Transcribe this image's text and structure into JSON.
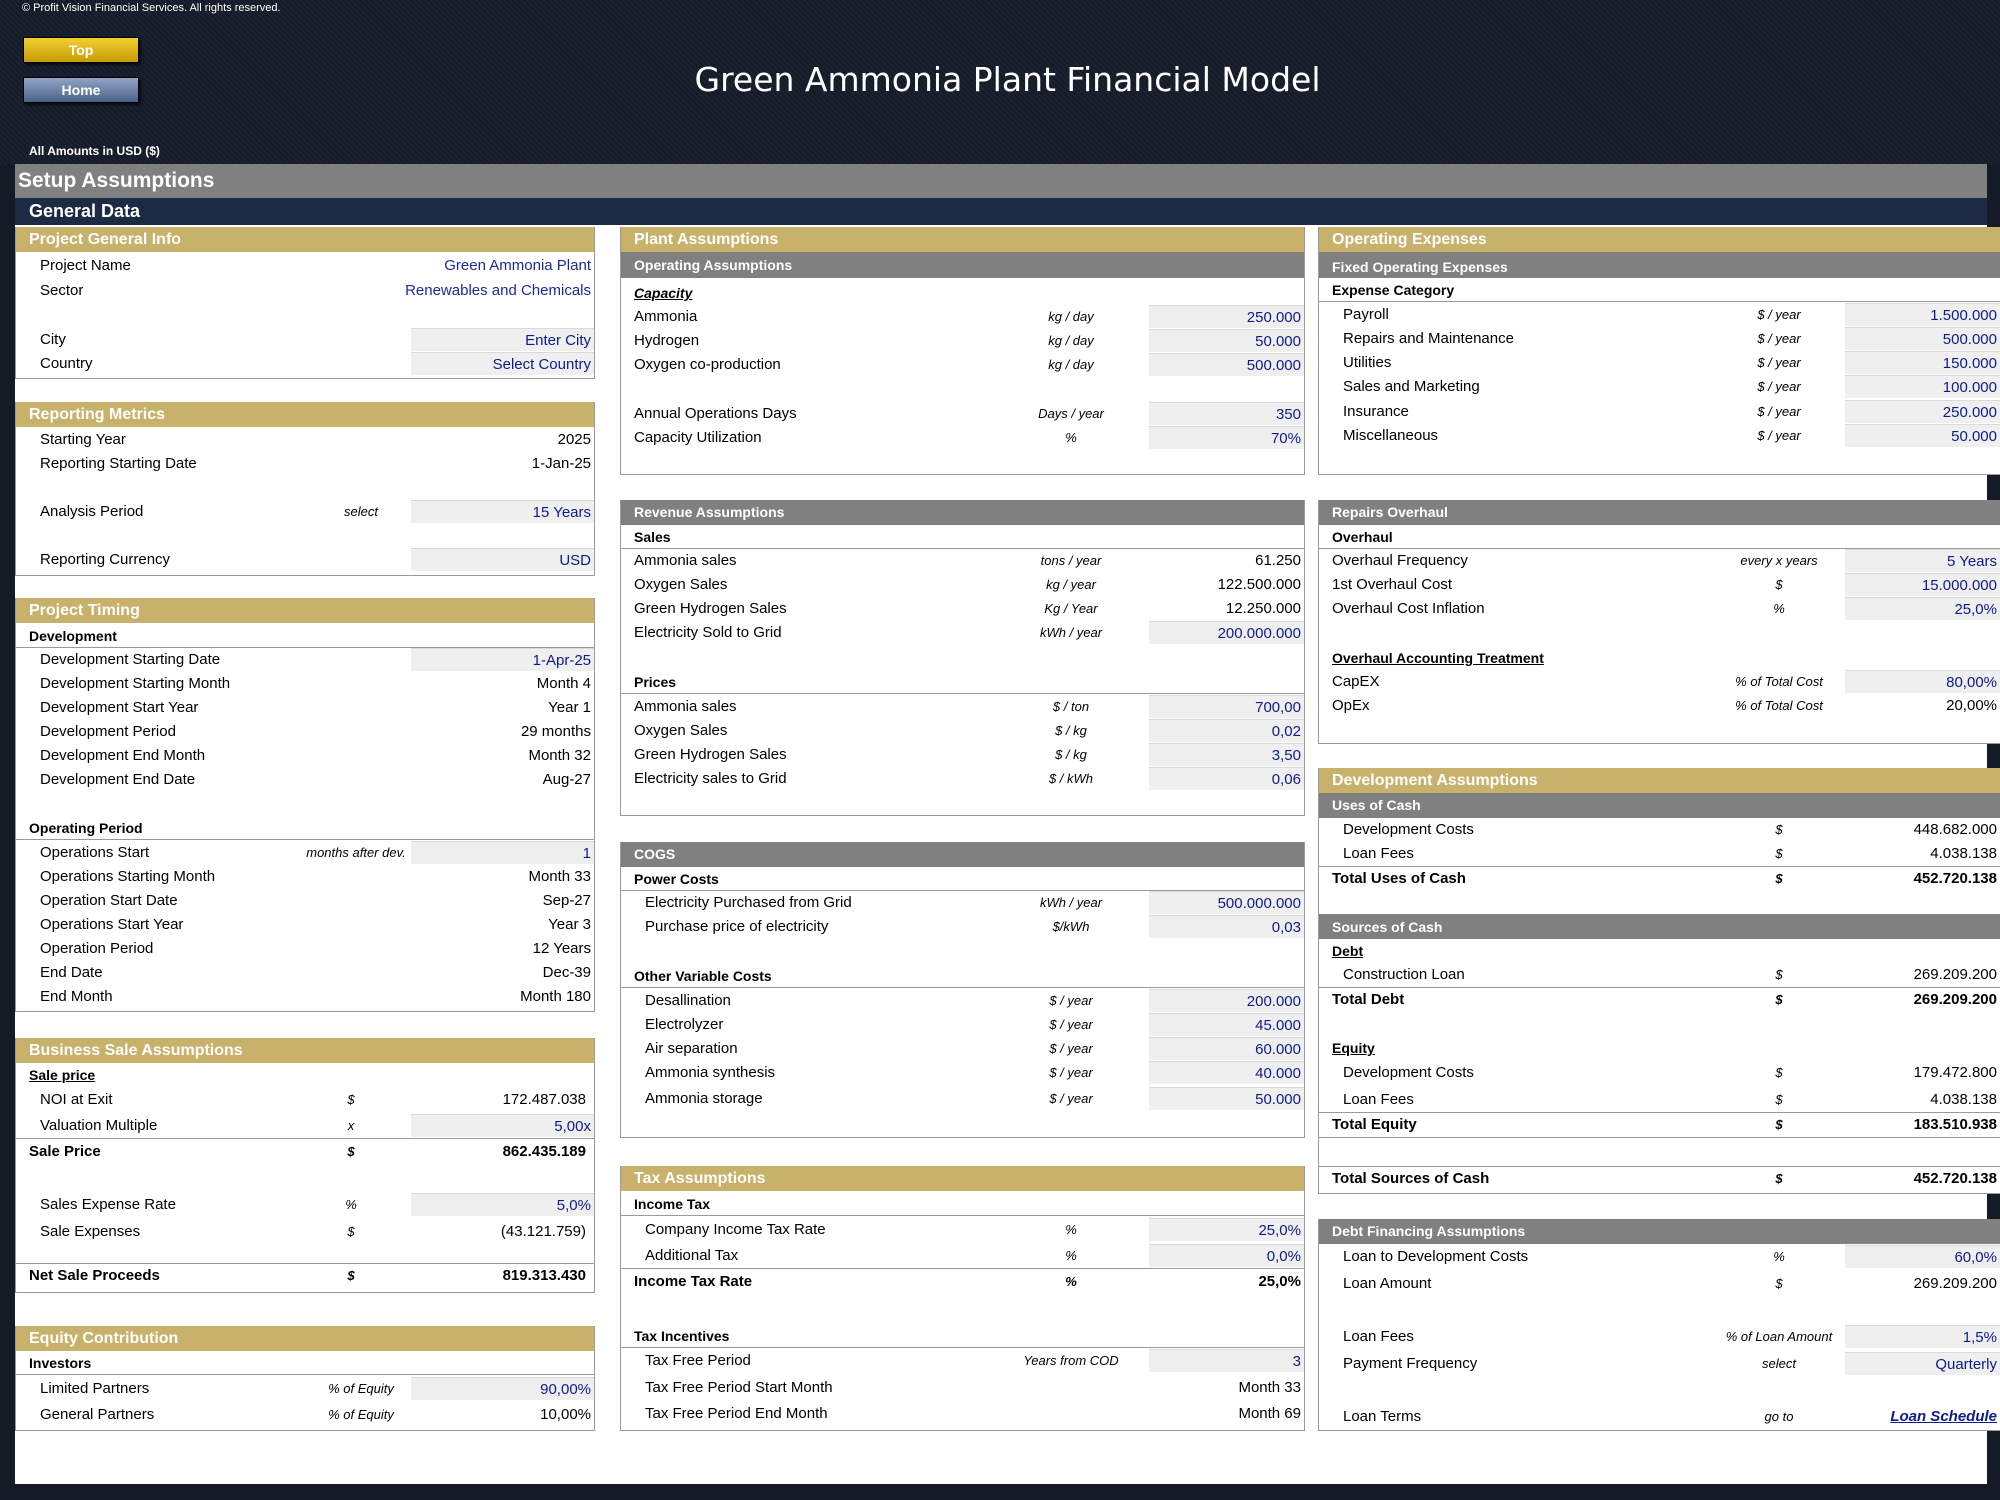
{
  "header": {
    "copyright": "© Profit Vision Financial Services. All rights reserved.",
    "top_button": "Top",
    "home_button": "Home",
    "title": "Green Ammonia Plant Financial Model",
    "amounts": "All Amounts in  USD ($)"
  },
  "sheet": {
    "setup": "Setup Assumptions",
    "general": "General Data"
  },
  "pgi": {
    "title": "Project General Info",
    "project_name_label": "Project Name",
    "project_name": "Green Ammonia Plant",
    "sector_label": "Sector",
    "sector": "Renewables and Chemicals",
    "city_label": "City",
    "city": "Enter City",
    "country_label": "Country",
    "country": "Select Country"
  },
  "rm": {
    "title": "Reporting Metrics",
    "starting_year_label": "Starting Year",
    "starting_year": "2025",
    "start_date_label": "Reporting Starting Date",
    "start_date": "1-Jan-25",
    "analysis_label": "Analysis Period",
    "analysis_unit": "select",
    "analysis": "15 Years",
    "currency_label": "Reporting Currency",
    "currency": "USD"
  },
  "pt": {
    "title": "Project Timing",
    "dev": "Development",
    "r1_label": "Development Starting Date",
    "r1": "1-Apr-25",
    "r2_label": "Development Starting Month",
    "r2": "Month 4",
    "r3_label": "Development Start Year",
    "r3": "Year 1",
    "r4_label": "Development Period",
    "r4": "29 months",
    "r5_label": "Development End Month",
    "r5": "Month 32",
    "r6_label": "Development End Date",
    "r6": "Aug-27",
    "op": "Operating Period",
    "o1_label": "Operations Start",
    "o1_unit": "months after dev.",
    "o1": "1",
    "o2_label": "Operations Starting Month",
    "o2": "Month 33",
    "o3_label": "Operation Start Date",
    "o3": "Sep-27",
    "o4_label": "Operations Start Year",
    "o4": "Year 3",
    "o5_label": "Operation Period",
    "o5": "12 Years",
    "o6_label": "End Date",
    "o6": "Dec-39",
    "o7_label": "End Month",
    "o7": "Month 180"
  },
  "bs": {
    "title": "Business Sale Assumptions",
    "sale_price_h": "Sale price",
    "noi_label": "NOI at Exit",
    "noi_unit": "$",
    "noi": "172.487.038",
    "vm_label": "Valuation Multiple",
    "vm_unit": "x",
    "vm": "5,00x",
    "sp_label": "Sale Price",
    "sp_unit": "$",
    "sp": "862.435.189",
    "ser_label": "Sales Expense Rate",
    "ser_unit": "%",
    "ser": "5,0%",
    "se_label": "Sale Expenses",
    "se_unit": "$",
    "se": "(43.121.759)",
    "nsp_label": "Net Sale Proceeds",
    "nsp_unit": "$",
    "nsp": "819.313.430"
  },
  "ec": {
    "title": "Equity Contribution",
    "investors": "Investors",
    "lp_label": "Limited Partners",
    "lp_unit": "% of Equity",
    "lp": "90,00%",
    "gp_label": "General Partners",
    "gp_unit": "% of Equity",
    "gp": "10,00%"
  },
  "pa": {
    "title": "Plant Assumptions",
    "sub": "Operating Assumptions",
    "capacity": "Capacity",
    "r1_label": "Ammonia",
    "r1_unit": "kg / day",
    "r1": "250.000",
    "r2_label": "Hydrogen",
    "r2_unit": "kg / day",
    "r2": "50.000",
    "r3_label": "Oxygen co-production",
    "r3_unit": "kg / day",
    "r3": "500.000",
    "r4_label": "Annual Operations Days",
    "r4_unit": "Days / year",
    "r4": "350",
    "r5_label": "Capacity Utilization",
    "r5_unit": "%",
    "r5": "70%"
  },
  "ra": {
    "title": "Revenue Assumptions",
    "sales": "Sales",
    "s1_label": "Ammonia sales",
    "s1_unit": "tons / year",
    "s1": "61.250",
    "s2_label": "Oxygen Sales",
    "s2_unit": "kg / year",
    "s2": "122.500.000",
    "s3_label": "Green Hydrogen Sales",
    "s3_unit": "Kg / Year",
    "s3": "12.250.000",
    "s4_label": "Electricity Sold to Grid",
    "s4_unit": "kWh / year",
    "s4": "200.000.000",
    "prices": "Prices",
    "p1_label": "Ammonia sales",
    "p1_unit": "$ / ton",
    "p1": "700,00",
    "p2_label": "Oxygen Sales",
    "p2_unit": "$ / kg",
    "p2": "0,02",
    "p3_label": "Green Hydrogen Sales",
    "p3_unit": "$ / kg",
    "p3": "3,50",
    "p4_label": "Electricity sales to Grid",
    "p4_unit": "$ / kWh",
    "p4": "0,06"
  },
  "cogs": {
    "title": "COGS",
    "power": "Power Costs",
    "pc1_label": "Electricity Purchased from Grid",
    "pc1_unit": "kWh / year",
    "pc1": "500.000.000",
    "pc2_label": "Purchase price of electricity",
    "pc2_unit": "$/kWh",
    "pc2": "0,03",
    "other": "Other Variable Costs",
    "v1_label": "Desallination",
    "v1_unit": "$ / year",
    "v1": "200.000",
    "v2_label": "Electrolyzer",
    "v2_unit": "$ / year",
    "v2": "45.000",
    "v3_label": "Air separation",
    "v3_unit": "$ / year",
    "v3": "60.000",
    "v4_label": "Ammonia synthesis",
    "v4_unit": "$ / year",
    "v4": "40.000",
    "v5_label": "Ammonia storage",
    "v5_unit": "$ / year",
    "v5": "50.000"
  },
  "tax": {
    "title": "Tax Assumptions",
    "income": "Income Tax",
    "t1_label": "Company Income Tax Rate",
    "t1_unit": "%",
    "t1": "25,0%",
    "t2_label": "Additional Tax",
    "t2_unit": "%",
    "t2": "0,0%",
    "t3_label": "Income Tax Rate",
    "t3_unit": "%",
    "t3": "25,0%",
    "incent": "Tax Incentives",
    "i1_label": "Tax Free Period",
    "i1_unit": "Years from COD",
    "i1": "3",
    "i2_label": "Tax Free Period Start Month",
    "i2": "Month 33",
    "i3_label": "Tax Free Period End Month",
    "i3": "Month 69"
  },
  "opex": {
    "title": "Operating Expenses",
    "sub": "Fixed Operating Expenses",
    "cat": "Expense Category",
    "e1_label": "Payroll",
    "e1_unit": "$ / year",
    "e1": "1.500.000",
    "e2_label": "Repairs and Maintenance",
    "e2_unit": "$ / year",
    "e2": "500.000",
    "e3_label": "Utilities",
    "e3_unit": "$ / year",
    "e3": "150.000",
    "e4_label": "Sales and Marketing",
    "e4_unit": "$ / year",
    "e4": "100.000",
    "e5_label": "Insurance",
    "e5_unit": "$ / year",
    "e5": "250.000",
    "e6_label": "Miscellaneous",
    "e6_unit": "$ / year",
    "e6": "50.000"
  },
  "ro": {
    "title": "Repairs Overhaul",
    "overhaul": "Overhaul",
    "r1_label": "Overhaul Frequency",
    "r1_unit": "every x years",
    "r1": "5 Years",
    "r2_label": "1st Overhaul Cost",
    "r2_unit": "$",
    "r2": "15.000.000",
    "r3_label": "Overhaul Cost Inflation",
    "r3_unit": "%",
    "r3": "25,0%",
    "treat": "Overhaul Accounting Treatment",
    "c1_label": "CapEX",
    "c1_unit": "% of Total Cost",
    "c1": "80,00%",
    "c2_label": "OpEx",
    "c2_unit": "% of Total Cost",
    "c2": "20,00%"
  },
  "da": {
    "title": "Development Assumptions",
    "uses": "Uses of Cash",
    "u1_label": "Development Costs",
    "u1_unit": "$",
    "u1": "448.682.000",
    "u2_label": "Loan Fees",
    "u2_unit": "$",
    "u2": "4.038.138",
    "u3_label": "Total Uses of Cash",
    "u3_unit": "$",
    "u3": "452.720.138",
    "sources": "Sources of Cash",
    "debt": "Debt",
    "d1_label": "Construction Loan",
    "d1_unit": "$",
    "d1": "269.209.200",
    "d2_label": "Total Debt",
    "d2_unit": "$",
    "d2": "269.209.200",
    "equity": "Equity",
    "q1_label": "Development Costs",
    "q1_unit": "$",
    "q1": "179.472.800",
    "q2_label": "Loan Fees",
    "q2_unit": "$",
    "q2": "4.038.138",
    "q3_label": "Total Equity",
    "q3_unit": "$",
    "q3": "183.510.938",
    "ts_label": "Total Sources of Cash",
    "ts_unit": "$",
    "ts": "452.720.138"
  },
  "dfa": {
    "title": "Debt Financing Assumptions",
    "l1_label": "Loan to Development Costs",
    "l1_unit": "%",
    "l1": "60,0%",
    "l2_label": "Loan Amount",
    "l2_unit": "$",
    "l2": "269.209.200",
    "l3_label": "Loan Fees",
    "l3_unit": "% of Loan Amount",
    "l3": "1,5%",
    "l4_label": "Payment Frequency",
    "l4_unit": "select",
    "l4": "Quarterly",
    "l5_label": "Loan Terms",
    "l5_unit": "go to",
    "l5": "Loan Schedule"
  }
}
